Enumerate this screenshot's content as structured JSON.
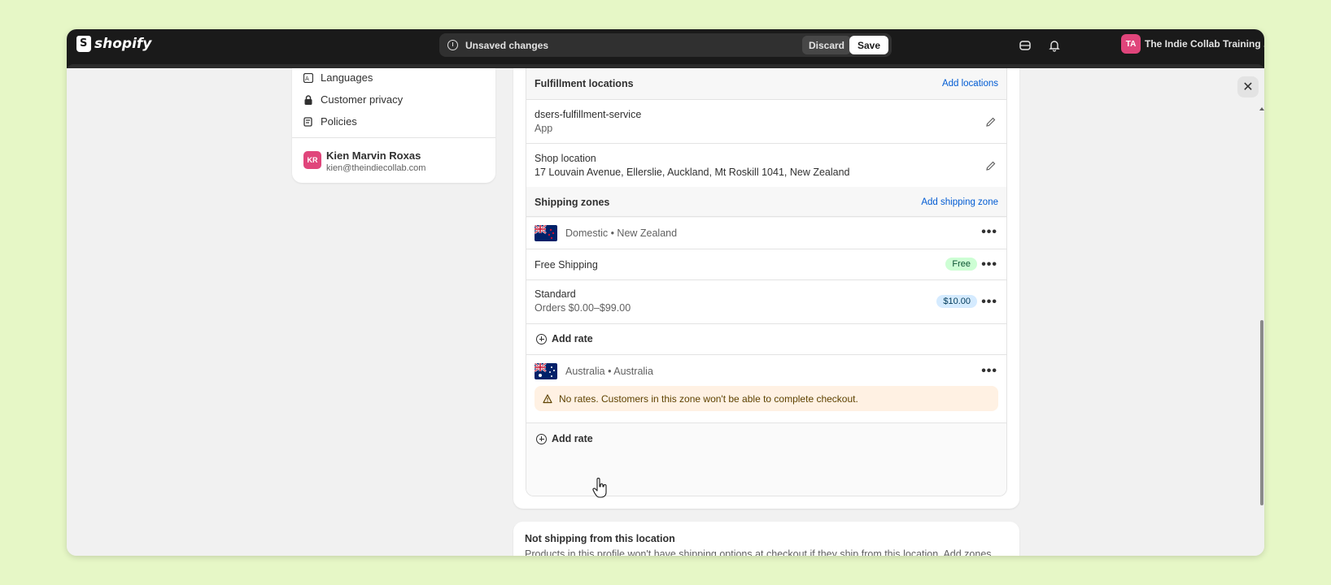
{
  "app": {
    "brand": "shopify"
  },
  "topbar": {
    "unsaved_text": "Unsaved changes",
    "discard_label": "Discard",
    "save_label": "Save",
    "store_initials": "TA",
    "store_name": "The Indie Collab Training ..."
  },
  "sidebar": {
    "items": [
      {
        "label": "Languages",
        "icon": "languages-icon"
      },
      {
        "label": "Customer privacy",
        "icon": "lock-icon"
      },
      {
        "label": "Policies",
        "icon": "policies-icon"
      }
    ],
    "user": {
      "initials": "KR",
      "name": "Kien Marvin Roxas",
      "email": "kien@theindiecollab.com"
    }
  },
  "fulfillment": {
    "title": "Fulfillment locations",
    "add_link": "Add locations",
    "locations": [
      {
        "name": "dsers-fulfillment-service",
        "detail": "App"
      },
      {
        "name": "Shop location",
        "detail": "17 Louvain Avenue, Ellerslie, Auckland, Mt Roskill 1041, New Zealand"
      }
    ]
  },
  "zones": {
    "title": "Shipping zones",
    "add_link": "Add shipping zone",
    "domestic": {
      "label": "Domestic • New Zealand",
      "rates": [
        {
          "name": "Free Shipping",
          "condition": "",
          "price": "Free"
        },
        {
          "name": "Standard",
          "condition": "Orders $0.00–$99.00",
          "price": "$10.00"
        }
      ],
      "add_rate": "Add rate"
    },
    "australia": {
      "label": "Australia • Australia",
      "warning": "No rates. Customers in this zone won't be able to complete checkout.",
      "add_rate": "Add rate"
    }
  },
  "not_shipping": {
    "title": "Not shipping from this location",
    "text": "Products in this profile won't have shipping options at checkout if they ship from this location. Add zones and rates to ship from this location."
  },
  "colors": {
    "accent_link": "#005bd3",
    "avatar_pink": "#e0457b",
    "warning_bg": "#fff1e3"
  }
}
